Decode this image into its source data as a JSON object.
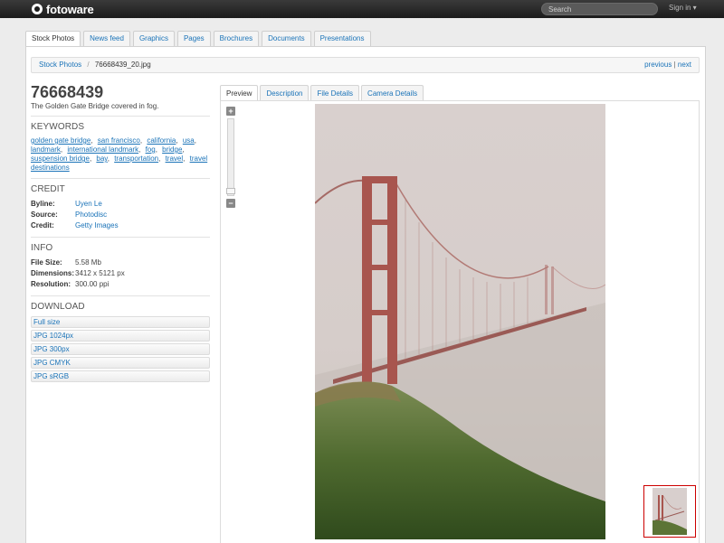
{
  "app": {
    "logo_text": "fotoware",
    "search_placeholder": "Search",
    "signin_label": "Sign in ▾"
  },
  "archive_tabs": [
    {
      "label": "Stock Photos",
      "active": true
    },
    {
      "label": "News feed"
    },
    {
      "label": "Graphics"
    },
    {
      "label": "Pages"
    },
    {
      "label": "Brochures"
    },
    {
      "label": "Documents"
    },
    {
      "label": "Presentations"
    }
  ],
  "breadcrumb": {
    "root": "Stock Photos",
    "separator": "/",
    "current": "76668439_20.jpg",
    "previous": "previous",
    "pipe": "|",
    "next": "next"
  },
  "asset": {
    "id": "76668439",
    "caption": "The Golden Gate Bridge covered in fog."
  },
  "keywords": {
    "heading": "KEYWORDS",
    "items": [
      "golden gate bridge",
      "san francisco",
      "california",
      "usa",
      "landmark",
      "international landmark",
      "fog",
      "bridge",
      "suspension bridge",
      "bay",
      "transportation",
      "travel",
      "travel destinations"
    ]
  },
  "credit": {
    "heading": "CREDIT",
    "byline_label": "Byline:",
    "byline": "Uyen Le",
    "source_label": "Source:",
    "source": "Photodisc",
    "credit_label": "Credit:",
    "credit": "Getty Images"
  },
  "info": {
    "heading": "INFO",
    "filesize_label": "File Size:",
    "filesize": "5.58 Mb",
    "dimensions_label": "Dimensions:",
    "dimensions": "3412 x 5121 px",
    "resolution_label": "Resolution:",
    "resolution": "300.00 ppi"
  },
  "download": {
    "heading": "DOWNLOAD",
    "options": [
      "Full size",
      "JPG 1024px",
      "JPG 300px",
      "JPG CMYK",
      "JPG sRGB"
    ]
  },
  "viewer_tabs": [
    {
      "label": "Preview",
      "active": true
    },
    {
      "label": "Description"
    },
    {
      "label": "File Details"
    },
    {
      "label": "Camera Details"
    }
  ],
  "zoom": {
    "plus": "+",
    "minus": "−",
    "level": 0.05
  },
  "colors": {
    "link": "#1a73b8",
    "topbar": "#222222",
    "thumb_border": "#cc0000"
  }
}
